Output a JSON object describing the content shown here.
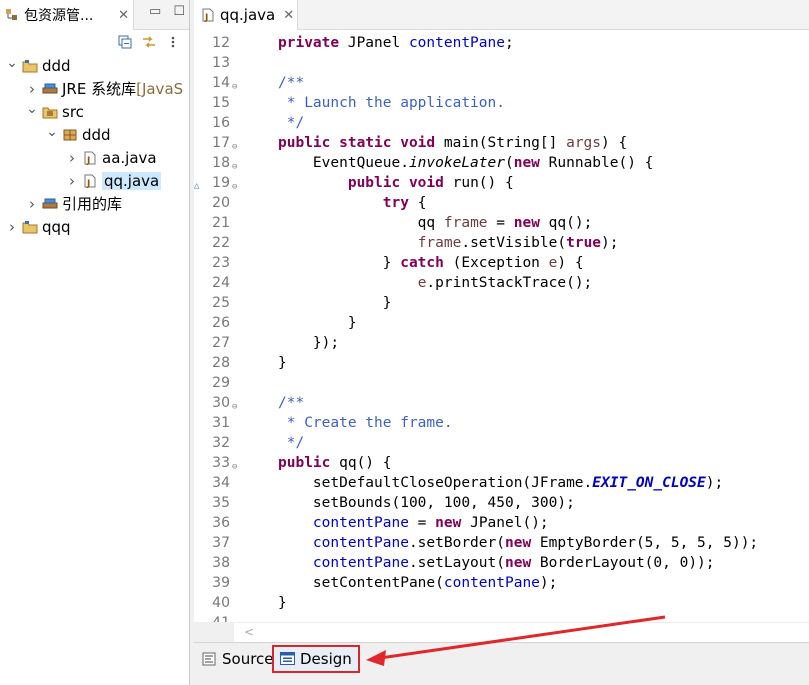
{
  "explorer": {
    "tab_label": "包资源管...",
    "close": "✕",
    "minimize": "▭",
    "maximize": "☐",
    "tree": [
      {
        "label": "ddd",
        "level": 0,
        "expanded": true,
        "icon": "project-icon"
      },
      {
        "label": "JRE 系统库",
        "deco": " [JavaS",
        "level": 1,
        "expanded": false,
        "icon": "library-icon"
      },
      {
        "label": "src",
        "level": 1,
        "expanded": true,
        "icon": "source-folder-icon"
      },
      {
        "label": "ddd",
        "level": 2,
        "expanded": true,
        "icon": "package-icon"
      },
      {
        "label": "aa.java",
        "level": 3,
        "expanded": false,
        "icon": "java-file-icon"
      },
      {
        "label": "qq.java",
        "level": 3,
        "expanded": false,
        "icon": "java-file-icon",
        "selected": true
      },
      {
        "label": "引用的库",
        "level": 1,
        "expanded": false,
        "icon": "library-icon"
      },
      {
        "label": "qqq",
        "level": 0,
        "expanded": false,
        "icon": "project-icon"
      }
    ]
  },
  "editor": {
    "tab_label": "qq.java",
    "close": "✕",
    "lines": [
      {
        "n": "12",
        "fold": "",
        "over": "",
        "html": "<span class='kw'>private</span> JPanel <span class='fld'>contentPane</span>;"
      },
      {
        "n": "13",
        "fold": "",
        "over": "",
        "html": ""
      },
      {
        "n": "14",
        "fold": "⊖",
        "over": "",
        "html": "<span class='cmt'>/**</span>"
      },
      {
        "n": "15",
        "fold": "",
        "over": "",
        "html": "<span class='cmt'> * Launch the application.</span>"
      },
      {
        "n": "16",
        "fold": "",
        "over": "",
        "html": "<span class='cmt'> */</span>"
      },
      {
        "n": "17",
        "fold": "⊖",
        "over": "",
        "html": "<span class='kw'>public static void</span> main(String[] <span class='loc'>args</span>) {"
      },
      {
        "n": "18",
        "fold": "⊖",
        "over": "",
        "html": "    EventQueue.<span class='ital'>invokeLater</span>(<span class='kw'>new</span> Runnable() {"
      },
      {
        "n": "19",
        "fold": "⊖",
        "over": "△",
        "html": "        <span class='kw'>public void</span> run() {"
      },
      {
        "n": "20",
        "fold": "",
        "over": "",
        "html": "            <span class='kw'>try</span> {"
      },
      {
        "n": "21",
        "fold": "",
        "over": "",
        "html": "                qq <span class='loc'>frame</span> = <span class='kw'>new</span> qq();"
      },
      {
        "n": "22",
        "fold": "",
        "over": "",
        "html": "                <span class='loc'>frame</span>.setVisible(<span class='kw'>true</span>);"
      },
      {
        "n": "23",
        "fold": "",
        "over": "",
        "html": "            } <span class='kw'>catch</span> (Exception <span class='loc'>e</span>) {"
      },
      {
        "n": "24",
        "fold": "",
        "over": "",
        "html": "                <span class='loc'>e</span>.printStackTrace();"
      },
      {
        "n": "25",
        "fold": "",
        "over": "",
        "html": "            }"
      },
      {
        "n": "26",
        "fold": "",
        "over": "",
        "html": "        }"
      },
      {
        "n": "27",
        "fold": "",
        "over": "",
        "html": "    });"
      },
      {
        "n": "28",
        "fold": "",
        "over": "",
        "html": "}"
      },
      {
        "n": "29",
        "fold": "",
        "over": "",
        "html": ""
      },
      {
        "n": "30",
        "fold": "⊖",
        "over": "",
        "html": "<span class='cmt'>/**</span>"
      },
      {
        "n": "31",
        "fold": "",
        "over": "",
        "html": "<span class='cmt'> * Create the frame.</span>"
      },
      {
        "n": "32",
        "fold": "",
        "over": "",
        "html": "<span class='cmt'> */</span>"
      },
      {
        "n": "33",
        "fold": "⊖",
        "over": "",
        "html": "<span class='kw'>public</span> qq() {"
      },
      {
        "n": "34",
        "fold": "",
        "over": "",
        "html": "    setDefaultCloseOperation(JFrame.<span class='stat'>EXIT_ON_CLOSE</span>);"
      },
      {
        "n": "35",
        "fold": "",
        "over": "",
        "html": "    setBounds(100, 100, 450, 300);"
      },
      {
        "n": "36",
        "fold": "",
        "over": "",
        "html": "    <span class='fld'>contentPane</span> = <span class='kw'>new</span> JPanel();"
      },
      {
        "n": "37",
        "fold": "",
        "over": "",
        "html": "    <span class='fld'>contentPane</span>.setBorder(<span class='kw'>new</span> EmptyBorder(5, 5, 5, 5));"
      },
      {
        "n": "38",
        "fold": "",
        "over": "",
        "html": "    <span class='fld'>contentPane</span>.setLayout(<span class='kw'>new</span> BorderLayout(0, 0));"
      },
      {
        "n": "39",
        "fold": "",
        "over": "",
        "html": "    setContentPane(<span class='fld'>contentPane</span>);"
      },
      {
        "n": "40",
        "fold": "",
        "over": "",
        "html": "}"
      },
      {
        "n": "41",
        "fold": "",
        "over": "",
        "html": ""
      }
    ]
  },
  "bottom_tabs": {
    "source_label": "Source",
    "design_label": "Design"
  },
  "colors": {
    "keyword": "#7f0055",
    "field": "#0000c0",
    "comment": "#3f5fbf",
    "highlight": "#d7262e"
  }
}
